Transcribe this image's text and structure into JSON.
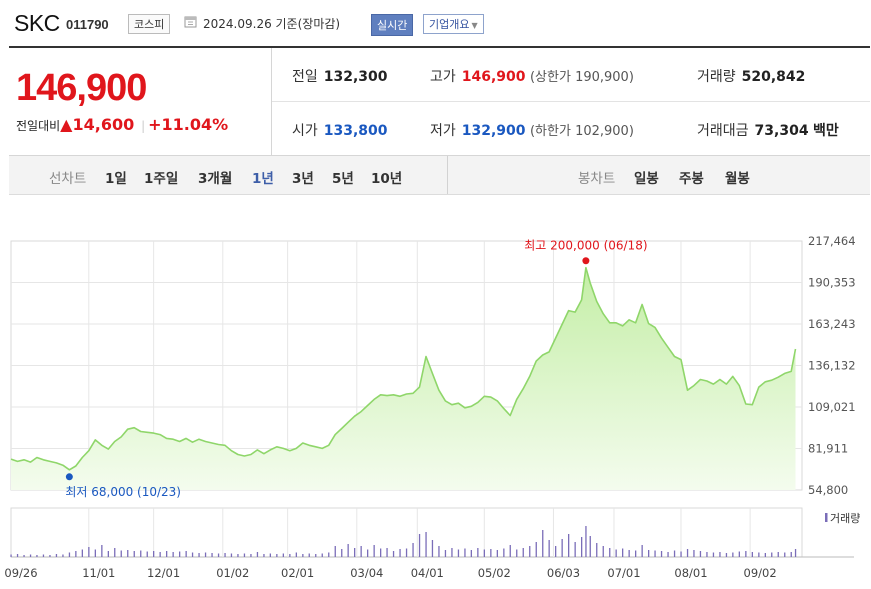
{
  "header": {
    "name": "SKC",
    "code": "011790",
    "market": "코스피",
    "date": "2024.09.26 기준(장마감)",
    "realtime": "실시간",
    "company_info": "기업개요"
  },
  "quote": {
    "price": "146,900",
    "change_label": "전일대비",
    "change_arrow": "▲",
    "change_value": "14,600",
    "change_sep": "|",
    "change_pct": "+11.04%",
    "prev_label": "전일",
    "prev_value": "132,300",
    "open_label": "시가",
    "open_value": "133,800",
    "high_label": "고가",
    "high_value": "146,900",
    "upper_limit": "(상한가 190,900)",
    "low_label": "저가",
    "low_value": "132,900",
    "lower_limit": "(하한가 102,900)",
    "volume_label": "거래량",
    "volume_value": "520,842",
    "amount_label": "거래대금",
    "amount_value": "73,304",
    "amount_unit": "백만"
  },
  "tabs": {
    "line_label": "선차트",
    "line_items": [
      "1일",
      "1주일",
      "3개월",
      "1년",
      "3년",
      "5년",
      "10년"
    ],
    "line_selected": "1년",
    "candle_label": "봉차트",
    "candle_items": [
      "일봉",
      "주봉",
      "월봉"
    ]
  },
  "colors": {
    "up": "#e0161c",
    "down": "#1a58c0",
    "line": "#8fd66a",
    "fill_top": "#c4eea6",
    "fill_bottom": "#f4fcee",
    "volume": "#7a6db8",
    "accent": "#5f7fbf"
  },
  "chart_data": {
    "type": "area",
    "y_ticks": [
      "217,464",
      "190,353",
      "163,243",
      "136,132",
      "109,021",
      "81,911",
      "54,800"
    ],
    "ylim": [
      54800,
      217464
    ],
    "x_ticks": [
      "09/26",
      "11/01",
      "12/01",
      "01/02",
      "02/01",
      "03/04",
      "04/01",
      "05/02",
      "06/03",
      "07/01",
      "08/01",
      "09/02"
    ],
    "x_tick_days": [
      0,
      36,
      66,
      98,
      128,
      160,
      188,
      219,
      251,
      279,
      310,
      342
    ],
    "x_range_days": [
      0,
      366
    ],
    "max_label": "최고 200,000 (06/18)",
    "max_point": {
      "day": 266,
      "value": 200000
    },
    "min_label": "최저 68,000 (10/23)",
    "min_point": {
      "day": 27,
      "value": 68000
    },
    "volume_legend": "거래량",
    "price": [
      [
        0,
        75000
      ],
      [
        3,
        73500
      ],
      [
        6,
        74500
      ],
      [
        9,
        73000
      ],
      [
        12,
        76000
      ],
      [
        15,
        74500
      ],
      [
        18,
        73500
      ],
      [
        21,
        72500
      ],
      [
        24,
        71000
      ],
      [
        27,
        68000
      ],
      [
        30,
        70500
      ],
      [
        33,
        76000
      ],
      [
        36,
        80500
      ],
      [
        39,
        87500
      ],
      [
        42,
        84000
      ],
      [
        45,
        81500
      ],
      [
        48,
        86500
      ],
      [
        51,
        89500
      ],
      [
        54,
        94500
      ],
      [
        57,
        95500
      ],
      [
        60,
        93000
      ],
      [
        63,
        92500
      ],
      [
        66,
        92000
      ],
      [
        69,
        91000
      ],
      [
        72,
        88500
      ],
      [
        75,
        88000
      ],
      [
        78,
        86500
      ],
      [
        81,
        88500
      ],
      [
        84,
        86000
      ],
      [
        87,
        88000
      ],
      [
        90,
        86500
      ],
      [
        93,
        85500
      ],
      [
        96,
        84500
      ],
      [
        99,
        84000
      ],
      [
        102,
        80500
      ],
      [
        105,
        78000
      ],
      [
        108,
        77000
      ],
      [
        111,
        78000
      ],
      [
        114,
        81000
      ],
      [
        117,
        78500
      ],
      [
        120,
        81000
      ],
      [
        123,
        83000
      ],
      [
        126,
        82000
      ],
      [
        129,
        80500
      ],
      [
        132,
        82000
      ],
      [
        135,
        85500
      ],
      [
        138,
        84000
      ],
      [
        141,
        83000
      ],
      [
        144,
        82000
      ],
      [
        147,
        84000
      ],
      [
        150,
        91000
      ],
      [
        153,
        95000
      ],
      [
        156,
        99000
      ],
      [
        159,
        103000
      ],
      [
        162,
        106000
      ],
      [
        165,
        110000
      ],
      [
        168,
        114000
      ],
      [
        171,
        117000
      ],
      [
        174,
        116500
      ],
      [
        177,
        117000
      ],
      [
        180,
        116000
      ],
      [
        183,
        117500
      ],
      [
        186,
        118000
      ],
      [
        189,
        122000
      ],
      [
        192,
        142000
      ],
      [
        195,
        131000
      ],
      [
        198,
        120000
      ],
      [
        201,
        113000
      ],
      [
        204,
        110500
      ],
      [
        207,
        111500
      ],
      [
        210,
        108500
      ],
      [
        213,
        109500
      ],
      [
        216,
        112000
      ],
      [
        219,
        116000
      ],
      [
        222,
        115500
      ],
      [
        225,
        113000
      ],
      [
        228,
        108000
      ],
      [
        231,
        103500
      ],
      [
        234,
        114000
      ],
      [
        237,
        121000
      ],
      [
        240,
        129000
      ],
      [
        243,
        139000
      ],
      [
        246,
        143000
      ],
      [
        249,
        145000
      ],
      [
        252,
        154000
      ],
      [
        255,
        163000
      ],
      [
        258,
        172000
      ],
      [
        261,
        171000
      ],
      [
        264,
        179000
      ],
      [
        266,
        200000
      ],
      [
        268,
        190000
      ],
      [
        271,
        178000
      ],
      [
        274,
        170000
      ],
      [
        277,
        164000
      ],
      [
        280,
        164000
      ],
      [
        283,
        162000
      ],
      [
        286,
        166000
      ],
      [
        289,
        164000
      ],
      [
        292,
        176000
      ],
      [
        295,
        163500
      ],
      [
        298,
        161000
      ],
      [
        301,
        154000
      ],
      [
        304,
        148000
      ],
      [
        307,
        142000
      ],
      [
        310,
        140000
      ],
      [
        313,
        120000
      ],
      [
        316,
        123000
      ],
      [
        319,
        127000
      ],
      [
        322,
        126000
      ],
      [
        325,
        124000
      ],
      [
        328,
        127000
      ],
      [
        331,
        124000
      ],
      [
        334,
        129000
      ],
      [
        337,
        123000
      ],
      [
        340,
        111000
      ],
      [
        343,
        110500
      ],
      [
        346,
        122000
      ],
      [
        349,
        125500
      ],
      [
        352,
        126500
      ],
      [
        355,
        128500
      ],
      [
        358,
        131000
      ],
      [
        361,
        132300
      ],
      [
        363,
        146900
      ]
    ],
    "volume_max": 9,
    "volume": [
      [
        0,
        0.5
      ],
      [
        3,
        0.6
      ],
      [
        6,
        0.4
      ],
      [
        9,
        0.5
      ],
      [
        12,
        0.4
      ],
      [
        15,
        0.5
      ],
      [
        18,
        0.4
      ],
      [
        21,
        0.6
      ],
      [
        24,
        0.5
      ],
      [
        27,
        0.9
      ],
      [
        30,
        1.2
      ],
      [
        33,
        1.5
      ],
      [
        36,
        2
      ],
      [
        39,
        1.5
      ],
      [
        42,
        2.4
      ],
      [
        45,
        1.2
      ],
      [
        48,
        1.8
      ],
      [
        51,
        1.3
      ],
      [
        54,
        1.4
      ],
      [
        57,
        1.2
      ],
      [
        60,
        1.3
      ],
      [
        63,
        1.1
      ],
      [
        66,
        1.2
      ],
      [
        69,
        1
      ],
      [
        72,
        1.2
      ],
      [
        75,
        1
      ],
      [
        78,
        1.1
      ],
      [
        81,
        1.2
      ],
      [
        84,
        0.9
      ],
      [
        87,
        0.8
      ],
      [
        90,
        0.9
      ],
      [
        93,
        0.8
      ],
      [
        96,
        0.7
      ],
      [
        99,
        0.8
      ],
      [
        102,
        0.7
      ],
      [
        105,
        0.6
      ],
      [
        108,
        0.7
      ],
      [
        111,
        0.6
      ],
      [
        114,
        1
      ],
      [
        117,
        0.6
      ],
      [
        120,
        0.7
      ],
      [
        123,
        0.6
      ],
      [
        126,
        0.7
      ],
      [
        129,
        0.6
      ],
      [
        132,
        0.9
      ],
      [
        135,
        0.6
      ],
      [
        138,
        0.7
      ],
      [
        141,
        0.6
      ],
      [
        144,
        0.7
      ],
      [
        147,
        0.9
      ],
      [
        150,
        2.2
      ],
      [
        153,
        1.6
      ],
      [
        156,
        2.6
      ],
      [
        159,
        1.8
      ],
      [
        162,
        2.2
      ],
      [
        165,
        1.5
      ],
      [
        168,
        2.4
      ],
      [
        171,
        1.7
      ],
      [
        174,
        1.8
      ],
      [
        177,
        1.2
      ],
      [
        180,
        1.6
      ],
      [
        183,
        1.7
      ],
      [
        186,
        2.8
      ],
      [
        189,
        4.6
      ],
      [
        192,
        5
      ],
      [
        195,
        3.4
      ],
      [
        198,
        2.2
      ],
      [
        201,
        1.4
      ],
      [
        204,
        1.8
      ],
      [
        207,
        1.5
      ],
      [
        210,
        1.7
      ],
      [
        213,
        1.4
      ],
      [
        216,
        1.8
      ],
      [
        219,
        1.5
      ],
      [
        222,
        1.6
      ],
      [
        225,
        1.4
      ],
      [
        228,
        1.7
      ],
      [
        231,
        2.4
      ],
      [
        234,
        1.5
      ],
      [
        237,
        1.8
      ],
      [
        240,
        2.2
      ],
      [
        243,
        3
      ],
      [
        246,
        5.4
      ],
      [
        249,
        3.4
      ],
      [
        252,
        2.2
      ],
      [
        255,
        3.6
      ],
      [
        258,
        4.6
      ],
      [
        261,
        3
      ],
      [
        264,
        4
      ],
      [
        266,
        6.2
      ],
      [
        268,
        4.2
      ],
      [
        271,
        2.8
      ],
      [
        274,
        2.2
      ],
      [
        277,
        1.8
      ],
      [
        280,
        1.5
      ],
      [
        283,
        1.7
      ],
      [
        286,
        1.4
      ],
      [
        289,
        1.3
      ],
      [
        292,
        2.4
      ],
      [
        295,
        1.4
      ],
      [
        298,
        1.3
      ],
      [
        301,
        1.2
      ],
      [
        304,
        1
      ],
      [
        307,
        1.3
      ],
      [
        310,
        1.1
      ],
      [
        313,
        1.6
      ],
      [
        316,
        1.4
      ],
      [
        319,
        1.2
      ],
      [
        322,
        1
      ],
      [
        325,
        0.9
      ],
      [
        328,
        1
      ],
      [
        331,
        0.8
      ],
      [
        334,
        0.9
      ],
      [
        337,
        1.1
      ],
      [
        340,
        1.2
      ],
      [
        343,
        1
      ],
      [
        346,
        0.9
      ],
      [
        349,
        0.8
      ],
      [
        352,
        0.9
      ],
      [
        355,
        1
      ],
      [
        358,
        0.9
      ],
      [
        361,
        1
      ],
      [
        363,
        1.6
      ]
    ]
  }
}
